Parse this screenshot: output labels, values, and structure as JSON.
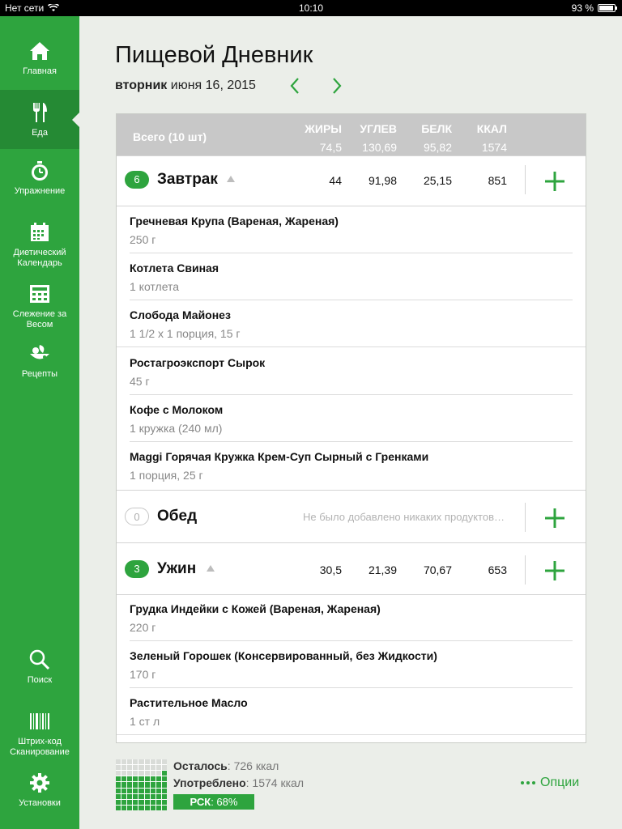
{
  "status_bar": {
    "carrier": "Нет сети",
    "time": "10:10",
    "battery": "93 %",
    "battery_level": 0.93
  },
  "sidebar": {
    "items": [
      {
        "label": "Главная",
        "icon": "home-icon"
      },
      {
        "label": "Еда",
        "icon": "fork-knife-icon",
        "active": true
      },
      {
        "label": "Упражнение",
        "icon": "stopwatch-icon"
      },
      {
        "label": "Диетический Календарь",
        "icon": "calendar-icon"
      },
      {
        "label": "Слежение за Весом",
        "icon": "scale-icon"
      },
      {
        "label": "Рецепты",
        "icon": "recipe-icon"
      }
    ],
    "bottom_items": [
      {
        "label": "Поиск",
        "icon": "search-icon"
      },
      {
        "label": "Штрих-код Сканирование",
        "icon": "barcode-icon"
      },
      {
        "label": "Установки",
        "icon": "gear-icon"
      }
    ]
  },
  "header": {
    "title": "Пищевой Дневник",
    "weekday": "вторник",
    "date": "июня 16, 2015"
  },
  "totals": {
    "label": "Всего (10 шт)",
    "columns": [
      "ЖИРЫ",
      "УГЛЕВ",
      "БЕЛК",
      "ККАЛ"
    ],
    "values": [
      "74,5",
      "130,69",
      "95,82",
      "1574"
    ]
  },
  "meals": [
    {
      "count": "6",
      "name": "Завтрак",
      "values": [
        "44",
        "91,98",
        "25,15",
        "851"
      ],
      "foods": [
        {
          "name": "Гречневая Крупа (Вареная, Жареная)",
          "serving": "250 г"
        },
        {
          "name": "Котлета Свиная",
          "serving": "1 котлета"
        },
        {
          "name": "Слобода Майонез",
          "serving": "1 1/2 x 1 порция, 15 г"
        },
        {
          "name": "Ростагроэкспорт Сырок",
          "serving": "45 г"
        },
        {
          "name": "Кофе с Молоком",
          "serving": "1 кружка (240 мл)"
        },
        {
          "name": "Maggi Горячая Кружка Крем-Суп Сырный с Гренками",
          "serving": "1 порция, 25 г"
        }
      ]
    },
    {
      "count": "0",
      "name": "Обед",
      "empty_note": "Не было добавлено никаких продуктов…",
      "foods": []
    },
    {
      "count": "3",
      "name": "Ужин",
      "values": [
        "30,5",
        "21,39",
        "70,67",
        "653"
      ],
      "foods": [
        {
          "name": "Грудка Индейки с Кожей (Вареная, Жареная)",
          "serving": "220 г"
        },
        {
          "name": "Зеленый Горошек (Консервированный, без Жидкости)",
          "serving": "170 г"
        },
        {
          "name": "Растительное Масло",
          "serving": "1 ст л"
        }
      ]
    }
  ],
  "summary": {
    "remaining_label": "Осталось",
    "remaining_value": ": 726 ккал",
    "consumed_label": "Употреблено",
    "consumed_value": ": 1574 ккал",
    "rsk_label": "РСК",
    "rsk_value": ": 68%",
    "rsk_fraction": 0.68,
    "options": "Опции"
  },
  "colors": {
    "accent": "#2ea43e",
    "accent_dark": "#258a34",
    "background": "#ebeee9"
  }
}
